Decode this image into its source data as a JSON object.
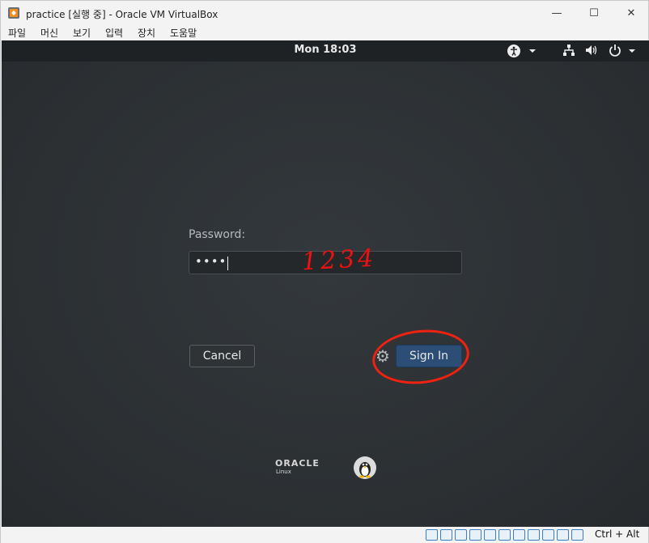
{
  "window": {
    "title": "practice [실행 중] - Oracle VM VirtualBox",
    "controls": {
      "minimize": "—",
      "maximize": "☐",
      "close": "✕"
    }
  },
  "menubar": {
    "items": [
      {
        "label": "파일"
      },
      {
        "label": "머신"
      },
      {
        "label": "보기"
      },
      {
        "label": "입력"
      },
      {
        "label": "장치"
      },
      {
        "label": "도움말"
      }
    ]
  },
  "gnome": {
    "clock": "Mon 18:03",
    "icons": {
      "accessibility": "accessibility-icon",
      "network": "network-icon",
      "volume": "volume-icon",
      "power": "power-icon"
    }
  },
  "login": {
    "password_label": "Password:",
    "password_value": "••••",
    "handwritten_note": "1234",
    "cancel_label": "Cancel",
    "signin_label": "Sign In"
  },
  "branding": {
    "logo_text": "ORACLE",
    "logo_subtext": "Linux"
  },
  "statusbar": {
    "host_key": "Ctrl + Alt"
  },
  "colors": {
    "signin_button": "#2c4d75",
    "annotation": "#ee1111",
    "vm_background": "#2d3033"
  }
}
